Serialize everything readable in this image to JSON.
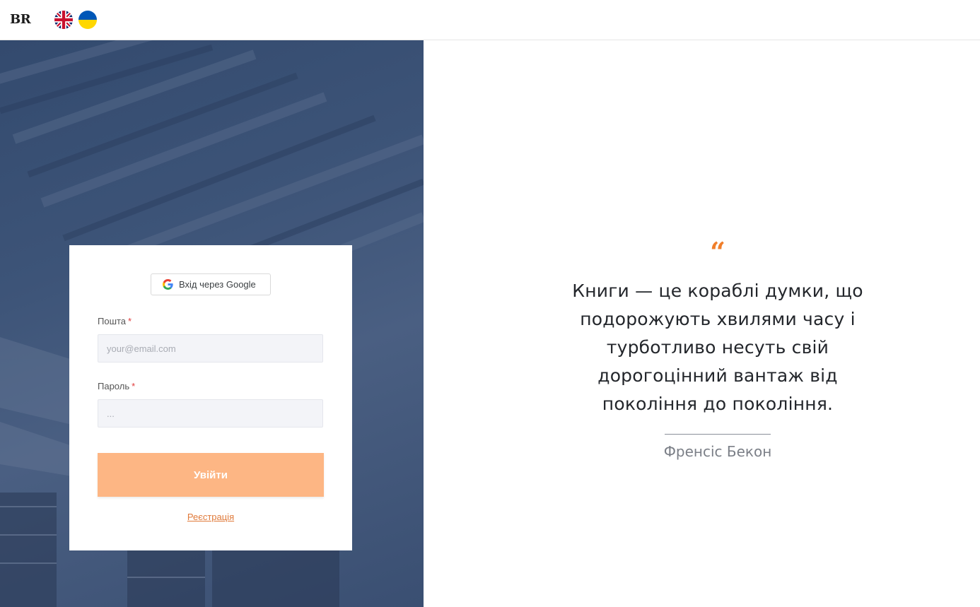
{
  "header": {
    "logo": "BR",
    "languages": [
      {
        "code": "en",
        "icon": "uk-flag-icon"
      },
      {
        "code": "uk",
        "icon": "ukraine-flag-icon"
      }
    ]
  },
  "login": {
    "google_label": "Вхід через Google",
    "email_label": "Пошта",
    "email_placeholder": "your@email.com",
    "password_label": "Пароль",
    "password_placeholder": "...",
    "required_mark": "*",
    "submit_label": "Увійти",
    "register_label": "Реєстрація"
  },
  "quote": {
    "mark": "“",
    "text": "Книги — це кораблі думки, що подорожують хвилями часу і турботливо несуть свій дорогоцінний вантаж від покоління до покоління.",
    "author": "Френсіс Бекон"
  },
  "colors": {
    "accent": "#fdb684",
    "quote_mark": "#f07e2a",
    "panel_bg": "#3d5478"
  }
}
